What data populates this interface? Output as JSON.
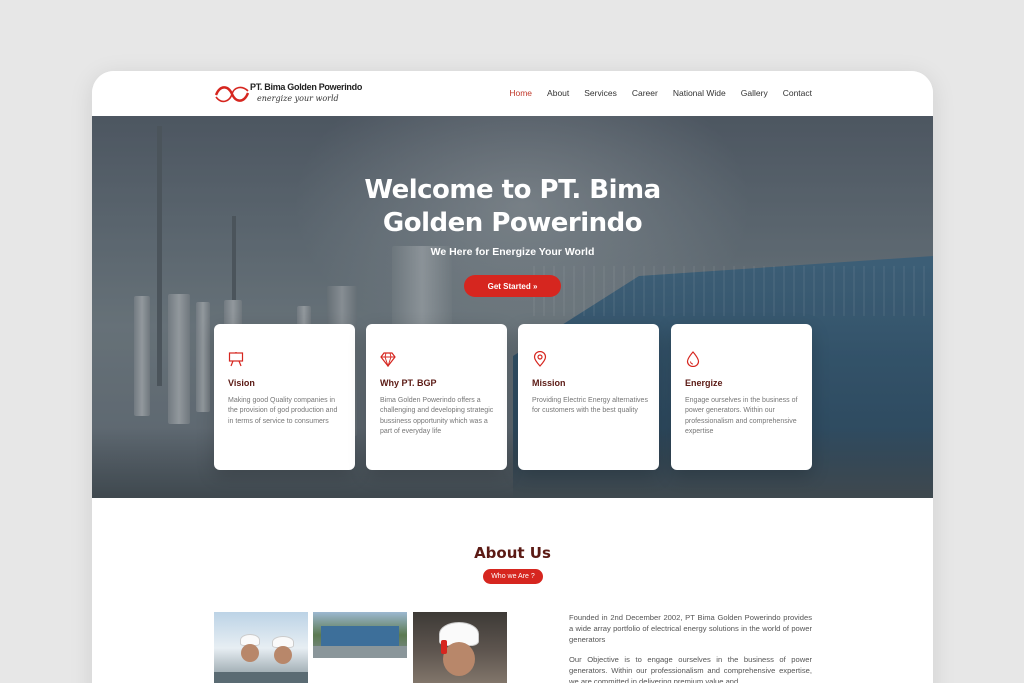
{
  "header": {
    "company": "PT. Bima Golden Powerindo",
    "tagline": "energize your world",
    "nav": [
      {
        "label": "Home",
        "active": true
      },
      {
        "label": "About"
      },
      {
        "label": "Services"
      },
      {
        "label": "Career"
      },
      {
        "label": "National Wide"
      },
      {
        "label": "Gallery"
      },
      {
        "label": "Contact"
      }
    ]
  },
  "hero": {
    "title_line1": "Welcome to PT. Bima",
    "title_line2": "Golden Powerindo",
    "subtitle": "We Here for Energize Your World",
    "cta_label": "Get Started »"
  },
  "cards": [
    {
      "icon": "easel-icon",
      "title": "Vision",
      "text": "Making good Quality companies in the provision of god production and in terms of service to consumers"
    },
    {
      "icon": "diamond-icon",
      "title": "Why PT. BGP",
      "text": "Bima Golden Powerindo offers a challenging and developing strategic bussiness opportunity which was a part of everyday life"
    },
    {
      "icon": "location-pin-icon",
      "title": "Mission",
      "text": "Providing Electric Energy alternatives for customers with the best quality"
    },
    {
      "icon": "drop-icon",
      "title": "Energize",
      "text": "Engage ourselves in the business of power generators. Within our professionalism and comprehensive expertise"
    }
  ],
  "about": {
    "title": "About Us",
    "badge": "Who we Are ?",
    "paragraph1": "Founded in 2nd December 2002, PT Bima Golden Powerindo provides a wide array portfolio of electrical energy solutions in the world of power generators",
    "paragraph2": "Our Objective is to engage ourselves in the business of power generators. Within our professionalism and comprehensive expertise, we are committed in delivering premium value and"
  },
  "colors": {
    "accent": "#d6261f",
    "heading": "#5b1a14",
    "nav_active": "#c0392b"
  }
}
